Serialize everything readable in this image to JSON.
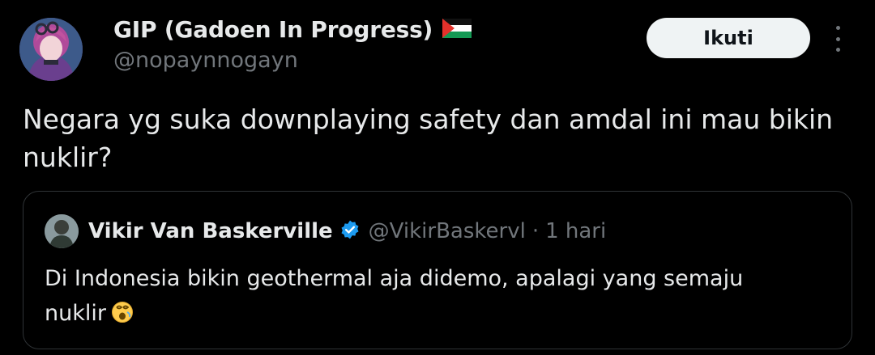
{
  "author": {
    "name": "GIP (Gadoen In Progress)",
    "flag_icon": "palestine-flag-icon",
    "handle": "@nopaynnogayn"
  },
  "actions": {
    "follow_label": "Ikuti",
    "more_icon": "more-vertical-icon"
  },
  "tweet": {
    "text": "Negara yg suka downplaying safety dan amdal ini mau bikin nuklir?"
  },
  "quote": {
    "name": "Vikir Van Baskerville",
    "verified_icon": "verified-badge-icon",
    "handle": "@VikirBaskervl",
    "separator": "·",
    "time": "1 hari",
    "text": "Di Indonesia bikin geothermal aja didemo, apalagi yang semaju nuklir",
    "emoji_icon": "dizzy-face-emoji"
  },
  "colors": {
    "background": "#000000",
    "text": "#e7e9ea",
    "muted": "#71767b",
    "border": "#2f3336",
    "verified": "#1d9bf0",
    "button_bg": "#eff3f4"
  }
}
